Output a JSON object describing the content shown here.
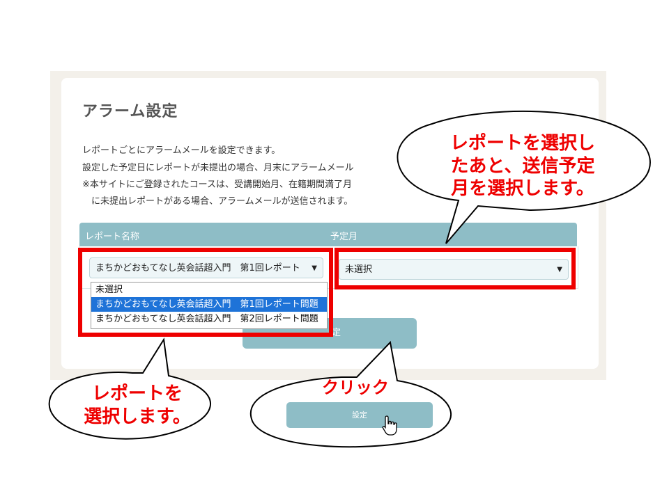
{
  "page": {
    "title": "アラーム設定",
    "description": [
      "レポートごとにアラームメールを設定できます。",
      "設定した予定日にレポートが未提出の場合、月末にアラームメール",
      "※本サイトにご登録されたコースは、受講開始月、在籍期間満了月",
      "　に未提出レポートがある場合、アラームメールが送信されます。"
    ]
  },
  "table": {
    "col_report": "レポート名称",
    "col_month": "予定月",
    "report_selected": "まちかどおもてなし英会話超入門　第1回レポート",
    "month_selected": "未選択",
    "dropdown_options": [
      "未選択",
      "まちかどおもてなし英会話超入門　第1回レポート問題",
      "まちかどおもてなし英会話超入門　第2回レポート問題"
    ],
    "button_label": "定"
  },
  "annotations": {
    "callout_top_right": [
      "レポートを選択し",
      "たあと、送信予定",
      "月を選択します。"
    ],
    "callout_bottom_left": [
      "レポートを",
      "選択します。"
    ],
    "callout_bottom_mid": "クリック",
    "set_button_label": "設定",
    "accent_color": "#ee0000",
    "teal_color": "#8ebdc6"
  },
  "icons": {
    "dropdown_arrow": "caret-down-icon",
    "hand": "hand-pointer-icon"
  }
}
